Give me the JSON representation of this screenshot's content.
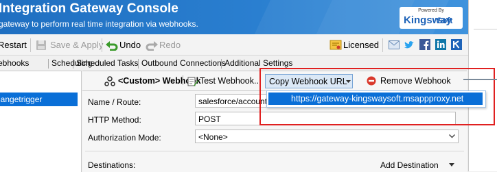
{
  "header": {
    "title": "Integration Gateway Console",
    "subtitle": "gateway to perform real time integration via webhooks.",
    "logo_powered": "Powered By",
    "logo_brand": "Kingsway",
    "logo_brand2": "Soft"
  },
  "toolbar": {
    "restart_label": "Restart",
    "save_label": "Save & Apply",
    "undo_label": "Undo",
    "redo_label": "Redo",
    "licensed_label": "Licensed"
  },
  "tabs": [
    "ebhooks",
    "Scheduling",
    "Scheduled Tasks",
    "Outbound Connections",
    "Additional Settings"
  ],
  "left_panel": {
    "selected_item": "hangetrigger"
  },
  "subtabs": {
    "custom_webhook": "<Custom> Webhook",
    "test_webhook": "Test Webhook...",
    "copy_url": "Copy Webhook URL",
    "remove": "Remove Webhook"
  },
  "dropdown": {
    "item": "https://gateway-kingswaysoft.msappproxy.net"
  },
  "form": {
    "name_label": "Name / Route:",
    "name_value": "salesforce/accountc",
    "method_label": "HTTP Method:",
    "method_value": "POST",
    "auth_label": "Authorization Mode:",
    "auth_value": "<None>",
    "destinations_label": "Destinations:",
    "add_destination": "Add Destination"
  },
  "colors": {
    "accent": "#0a6fd7",
    "highlight_box": "#e02020",
    "header": "#2a7fd0"
  }
}
